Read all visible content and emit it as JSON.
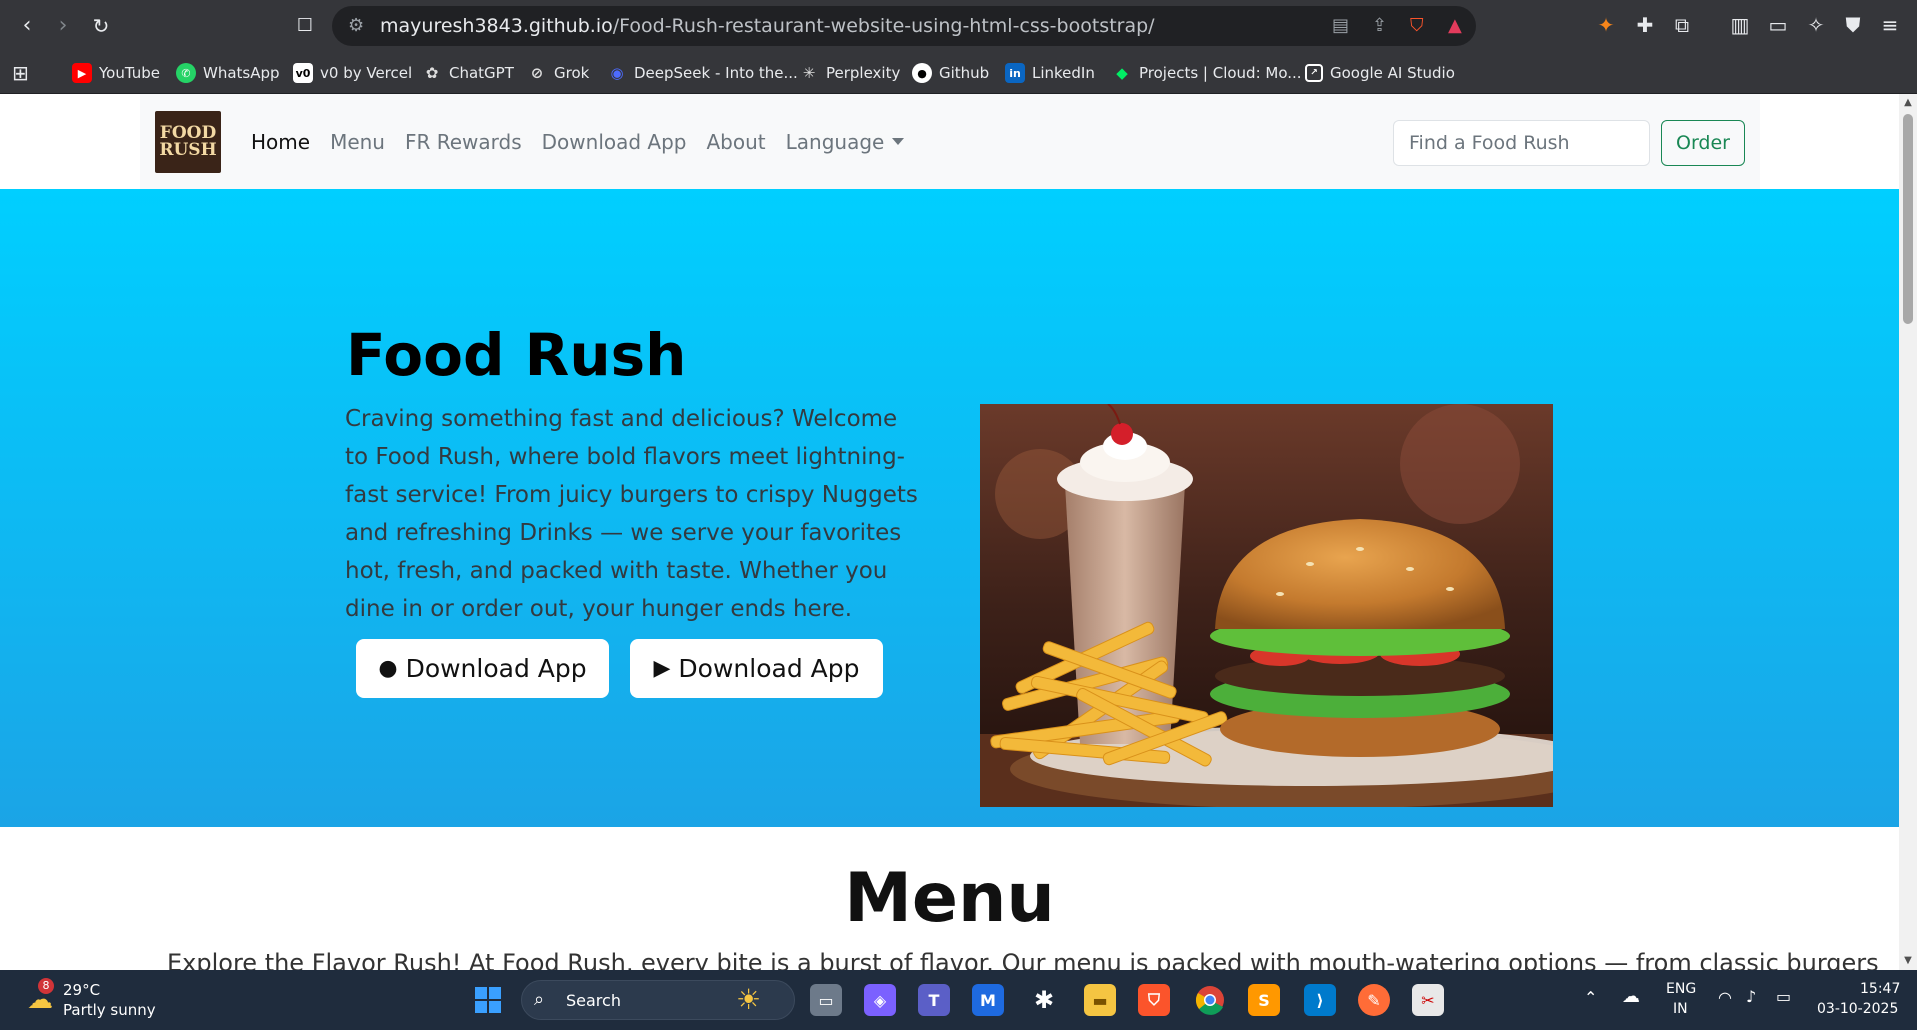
{
  "browser": {
    "url_host": "mayuresh3843.github.io",
    "url_path": "/Food-Rush-restaurant-website-using-html-css-bootstrap/",
    "bookmarks": [
      {
        "label": "YouTube",
        "color": "#ff0000"
      },
      {
        "label": "WhatsApp",
        "color": "#25d366"
      },
      {
        "label": "v0 by Vercel",
        "color": "#ffffff"
      },
      {
        "label": "ChatGPT",
        "color": "#cccccc"
      },
      {
        "label": "Grok",
        "color": "#cccccc"
      },
      {
        "label": "DeepSeek - Into the...",
        "color": "#4d6bfe"
      },
      {
        "label": "Perplexity",
        "color": "#cccccc"
      },
      {
        "label": "Github",
        "color": "#ffffff"
      },
      {
        "label": "LinkedIn",
        "color": "#0a66c2"
      },
      {
        "label": "Projects | Cloud: Mo...",
        "color": "#00ed64"
      },
      {
        "label": "Google AI Studio",
        "color": "#ffffff"
      }
    ]
  },
  "navbar": {
    "logo_line1": "FOOD",
    "logo_line2": "RUSH",
    "links": [
      "Home",
      "Menu",
      "FR Rewards",
      "Download App",
      "About",
      "Language"
    ],
    "search_placeholder": "Find a Food Rush",
    "order_label": "Order"
  },
  "hero": {
    "title": "Food Rush",
    "text": "Craving something fast and delicious? Welcome to Food Rush, where bold flavors meet lightning-fast service! From juicy burgers to crispy Nuggets and refreshing Drinks — we serve your favorites hot, fresh, and packed with taste. Whether you dine in or order out, your hunger ends here.",
    "btn_ios": "Download App",
    "btn_android": "Download App"
  },
  "menu": {
    "title": "Menu",
    "text": "Explore the Flavor Rush! At Food Rush, every bite is a burst of flavor. Our menu is packed with mouth-watering options — from classic burgers"
  },
  "taskbar": {
    "weather_temp": "29°C",
    "weather_desc": "Partly sunny",
    "weather_badge": "8",
    "search_label": "Search",
    "lang_line1": "ENG",
    "lang_line2": "IN",
    "time": "15:47",
    "date": "03-10-2025"
  },
  "colors": {
    "hero_top": "#00cfff",
    "hero_bottom": "#1ba4e6",
    "order_green": "#198754"
  }
}
